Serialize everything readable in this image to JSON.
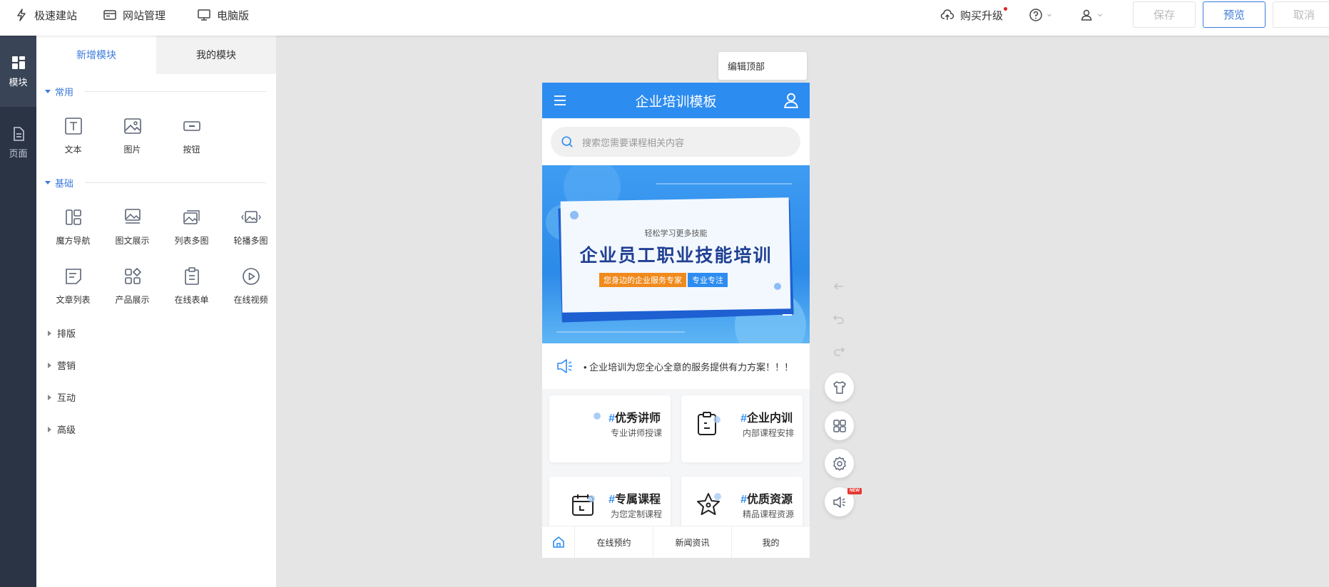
{
  "topbar": {
    "quick_build": "极速建站",
    "site_manage": "网站管理",
    "desktop": "电脑版",
    "upgrade": "购买升级",
    "save": "保存",
    "preview": "预览",
    "cancel": "取消"
  },
  "rail": {
    "modules": "模块",
    "pages": "页面"
  },
  "panel": {
    "tab_new": "新增模块",
    "tab_mine": "我的模块",
    "sec_common": "常用",
    "sec_basic": "基础",
    "common_items": [
      "文本",
      "图片",
      "按钮"
    ],
    "basic_items": [
      "魔方导航",
      "图文展示",
      "列表多图",
      "轮播多图",
      "文章列表",
      "产品展示",
      "在线表单",
      "在线视频"
    ],
    "collapsed": [
      "排版",
      "营销",
      "互动",
      "高级"
    ]
  },
  "canvas": {
    "edit_top": "编辑顶部",
    "phone_title": "企业培训模板",
    "search_placeholder": "搜索您需要课程相关内容",
    "banner_small": "轻松学习更多技能",
    "banner_title": "企业员工职业技能培训",
    "banner_tag1": "您身边的企业服务专家",
    "banner_tag2": "专业专注",
    "notice": "企业培训为您全心全意的服务提供有力方案！！！",
    "cards": [
      {
        "hash": "#",
        "title": "优秀讲师",
        "sub": "专业讲师授课"
      },
      {
        "hash": "#",
        "title": "企业内训",
        "sub": "内部课程安排"
      },
      {
        "hash": "#",
        "title": "专属课程",
        "sub": "为您定制课程"
      },
      {
        "hash": "#",
        "title": "优质资源",
        "sub": "精品课程资源"
      }
    ],
    "nav": [
      "在线预约",
      "新闻资讯",
      "我的"
    ],
    "new_badge": "NEW"
  },
  "colors": {
    "accent": "#3c7bdc",
    "phone_header": "#2d8cf0",
    "rail": "#2b3445"
  }
}
